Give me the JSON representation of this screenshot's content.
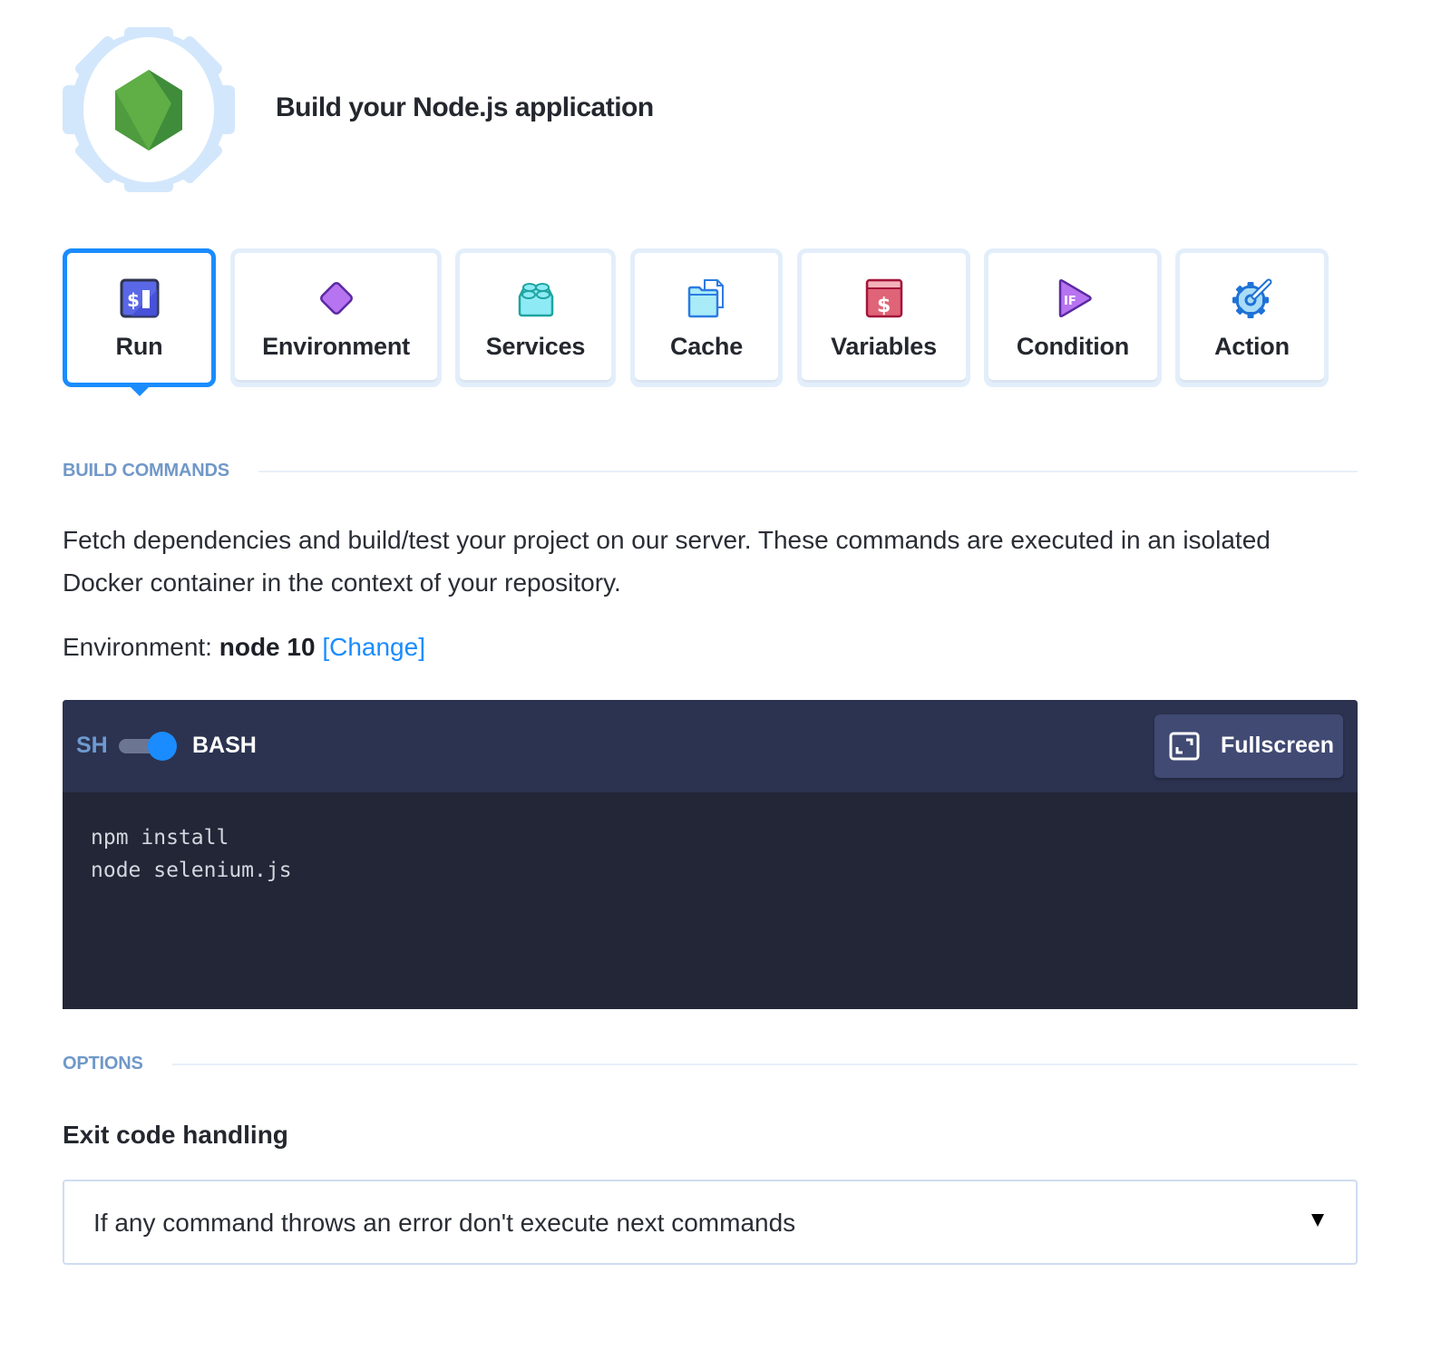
{
  "header": {
    "title": "Build your Node.js application",
    "logo_icon": "nodejs-hexagon-in-gear-icon"
  },
  "tabs": [
    {
      "label": "Run",
      "icon": "terminal-dollar-icon",
      "active": true
    },
    {
      "label": "Environment",
      "icon": "purple-diamond-icon",
      "active": false
    },
    {
      "label": "Services",
      "icon": "lego-brick-icon",
      "active": false
    },
    {
      "label": "Cache",
      "icon": "folder-file-icon",
      "active": false
    },
    {
      "label": "Variables",
      "icon": "dollar-card-icon",
      "active": false
    },
    {
      "label": "Condition",
      "icon": "if-play-icon",
      "active": false
    },
    {
      "label": "Action",
      "icon": "gear-wrench-icon",
      "active": false
    }
  ],
  "build_commands": {
    "section_label": "BUILD COMMANDS",
    "description": "Fetch dependencies and build/test your project on our server. These commands are executed in an isolated Docker container in the context of your repository.",
    "environment_prefix": "Environment: ",
    "environment_value": "node 10",
    "change_link": "[Change]"
  },
  "editor": {
    "shell_left": "SH",
    "shell_right": "BASH",
    "shell_toggle_on": true,
    "fullscreen_label": "Fullscreen",
    "code": "npm install\nnode selenium.js"
  },
  "options": {
    "section_label": "OPTIONS",
    "exit_code_label": "Exit code handling",
    "exit_code_value": "If any command throws an error don't execute next commands"
  },
  "colors": {
    "accent": "#1a8cff",
    "section_label": "#7098c8",
    "editor_bar": "#2c3350",
    "editor_bg": "#222636"
  }
}
